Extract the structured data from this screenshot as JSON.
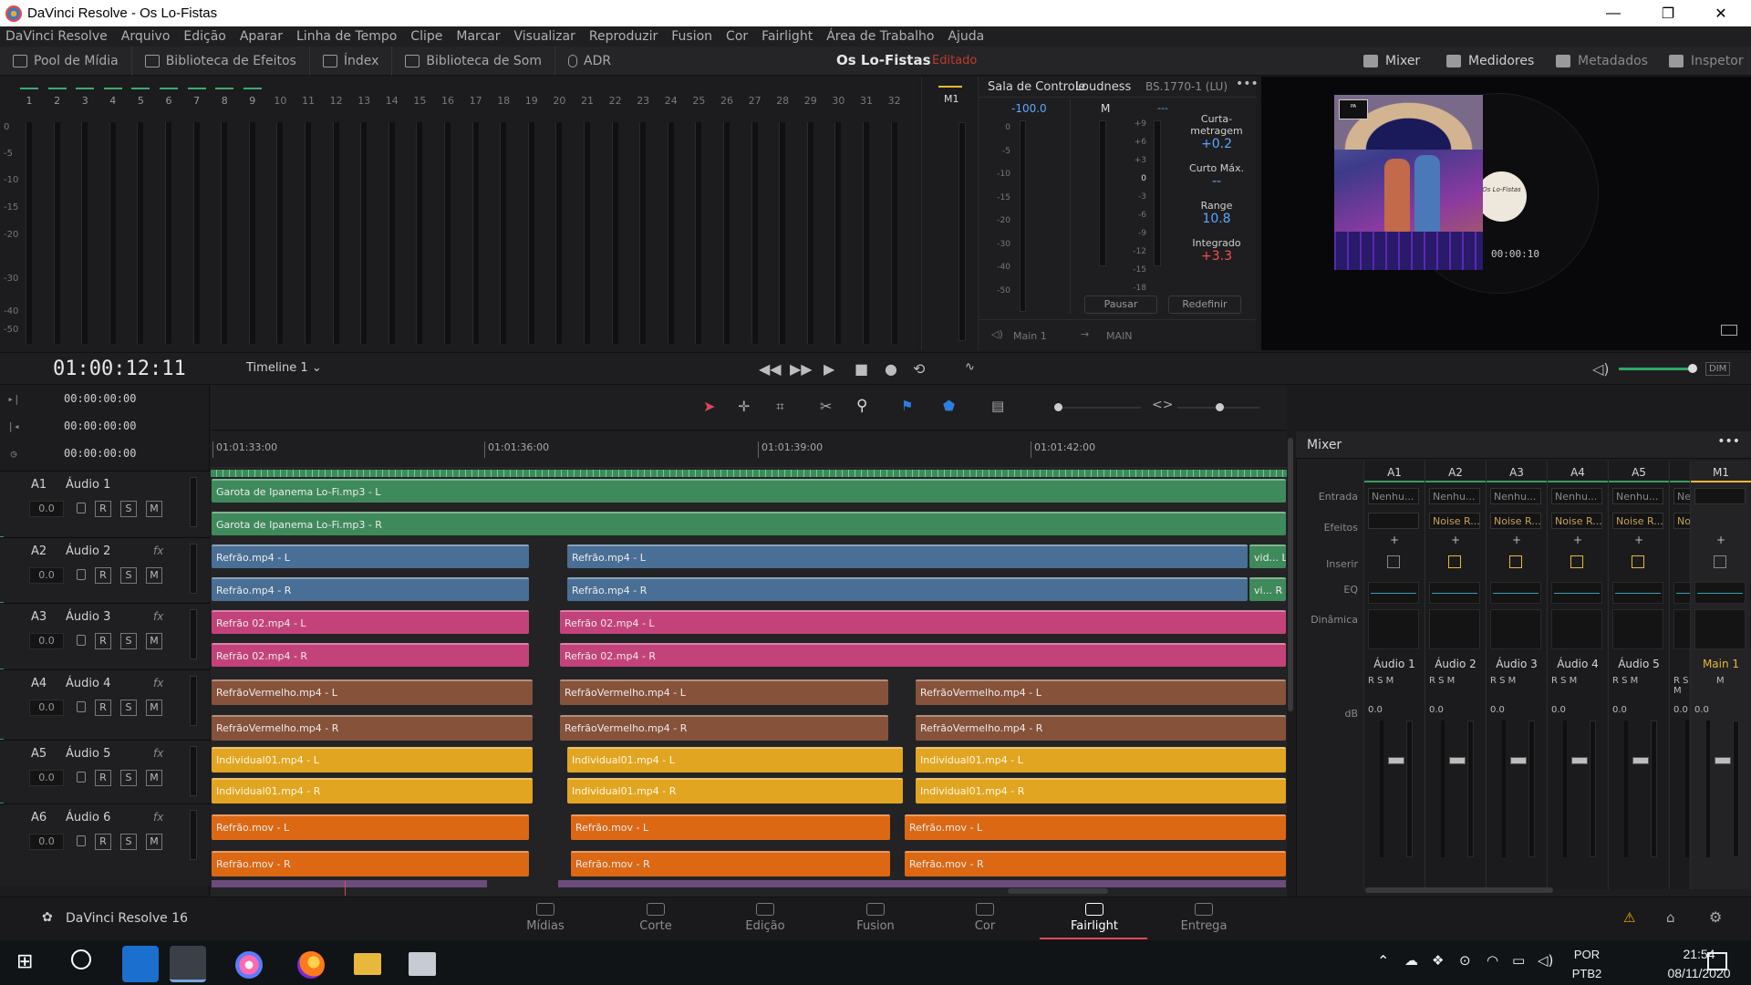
{
  "window": {
    "title": "DaVinci Resolve - Os Lo-Fistas",
    "controls": [
      "—",
      "❐",
      "✕"
    ]
  },
  "menu": [
    "DaVinci Resolve",
    "Arquivo",
    "Edição",
    "Aparar",
    "Linha de Tempo",
    "Clipe",
    "Marcar",
    "Visualizar",
    "Reproduzir",
    "Fusion",
    "Cor",
    "Fairlight",
    "Área de Trabalho",
    "Ajuda"
  ],
  "toolbar": {
    "left": [
      {
        "label": "Pool de Mídia",
        "icon": "media-pool-icon"
      },
      {
        "label": "Biblioteca de Efeitos",
        "icon": "effects-library-icon"
      },
      {
        "label": "Índex",
        "icon": "index-icon"
      },
      {
        "label": "Biblioteca de Som",
        "icon": "sound-library-icon"
      },
      {
        "label": "ADR",
        "icon": "microphone-icon"
      }
    ],
    "project_title": "Os Lo-Fistas",
    "project_status": "Editado",
    "right": [
      {
        "label": "Mixer",
        "icon": "mixer-icon"
      },
      {
        "label": "Medidores",
        "icon": "meters-icon"
      },
      {
        "label": "Metadados",
        "icon": "metadata-icon"
      },
      {
        "label": "Inspetor",
        "icon": "inspector-icon"
      }
    ]
  },
  "meters": {
    "channels": [
      "1",
      "2",
      "3",
      "4",
      "5",
      "6",
      "7",
      "8",
      "9",
      "10",
      "11",
      "12",
      "13",
      "14",
      "15",
      "16",
      "17",
      "18",
      "19",
      "20",
      "21",
      "22",
      "23",
      "24",
      "25",
      "26",
      "27",
      "28",
      "29",
      "30",
      "31",
      "32"
    ],
    "scale": [
      "0",
      "-5",
      "-10",
      "-15",
      "-20",
      "-30",
      "-40",
      "-50"
    ],
    "m1_label": "M1"
  },
  "control_room": {
    "title": "Sala de Controle",
    "level": "-100.0",
    "scale": [
      "0",
      "-5",
      "-10",
      "-15",
      "-20",
      "-30",
      "-40",
      "-50"
    ],
    "output": "Main 1",
    "route": "MAIN"
  },
  "loudness": {
    "title": "Loudness",
    "standard": "BS.1770-1 (LU)",
    "m_label": "M",
    "dash": "---",
    "scale": [
      "+9",
      "+6",
      "+3",
      "0",
      "-3",
      "-6",
      "-9",
      "-12",
      "-15",
      "-18"
    ],
    "readings": [
      {
        "label": "Curta-metragem",
        "value": "+0.2",
        "color": "#5aa7ff"
      },
      {
        "label": "Curto Máx.",
        "value": "--",
        "color": "#5aa7ff"
      },
      {
        "label": "Range",
        "value": "10.8",
        "color": "#5aa7ff"
      },
      {
        "label": "Integrado",
        "value": "+3.3",
        "color": "#ff4d4d"
      }
    ],
    "buttons": {
      "pause": "Pausar",
      "reset": "Redefinir"
    }
  },
  "viewer": {
    "record_text": "Os Lo-Fistas",
    "timecode_overlay": "00:00:10"
  },
  "transport": {
    "timecode": "01:00:12:11",
    "timeline": "Timeline 1"
  },
  "tc_rows": [
    "00:00:00:00",
    "00:00:00:00",
    "00:00:00:00"
  ],
  "ruler": [
    "01:01:33:00",
    "01:01:36:00",
    "01:01:39:00",
    "01:01:42:00"
  ],
  "tracks": [
    {
      "id": "A1",
      "name": "Áudio 1",
      "fx": "",
      "vol": "0.0"
    },
    {
      "id": "A2",
      "name": "Áudio 2",
      "fx": "fx",
      "vol": "0.0"
    },
    {
      "id": "A3",
      "name": "Áudio 3",
      "fx": "fx",
      "vol": "0.0"
    },
    {
      "id": "A4",
      "name": "Áudio 4",
      "fx": "fx",
      "vol": "0.0"
    },
    {
      "id": "A5",
      "name": "Áudio 5",
      "fx": "fx",
      "vol": "0.0"
    },
    {
      "id": "A6",
      "name": "Áudio 6",
      "fx": "fx",
      "vol": "0.0"
    }
  ],
  "track_buttons": [
    "R",
    "S",
    "M"
  ],
  "clips": {
    "a1": [
      "Garota de Ipanema Lo-Fi.mp3 - L",
      "Garota de Ipanema Lo-Fi.mp3 - R"
    ],
    "a2": [
      "Refrão.mp4 - L",
      "Refrão.mp4 - R",
      "Refrão.mp4 - L",
      "Refrão.mp4 - R",
      "vid... L",
      "vi... R"
    ],
    "a3": [
      "Refrão 02.mp4 - L",
      "Refrão 02.mp4 - R",
      "Refrão 02.mp4 - L",
      "Refrão 02.mp4 - R"
    ],
    "a4": [
      "RefrãoVermelho.mp4 - L",
      "RefrãoVermelho.mp4 - R",
      "RefrãoVermelho.mp4 - L",
      "RefrãoVermelho.mp4 - R",
      "RefrãoVermelho.mp4 - L",
      "RefrãoVermelho.mp4 - R"
    ],
    "a5": [
      "Individual01.mp4 - L",
      "Individual01.mp4 - R",
      "Individual01.mp4 - L",
      "Individual01.mp4 - R",
      "Individual01.mp4 - L",
      "Individual01.mp4 - R"
    ],
    "a6": [
      "Refrão.mov - L",
      "Refrão.mov - R",
      "Refrão.mov - L",
      "Refrão.mov - R",
      "Refrão.mov - L",
      "Refrão.mov - R"
    ]
  },
  "mixer": {
    "title": "Mixer",
    "row_labels": {
      "input": "Entrada",
      "effects": "Efeitos",
      "insert": "Inserir",
      "eq": "EQ",
      "dynamics": "Dinâmica",
      "db": "dB"
    },
    "channels": [
      {
        "id": "A1",
        "name": "Áudio 1",
        "input": "Nenhu...",
        "effect": "",
        "db": "0.0"
      },
      {
        "id": "A2",
        "name": "Áudio 2",
        "input": "Nenhu...",
        "effect": "Noise R...",
        "db": "0.0"
      },
      {
        "id": "A3",
        "name": "Áudio 3",
        "input": "Nenhu...",
        "effect": "Noise R...",
        "db": "0.0"
      },
      {
        "id": "A4",
        "name": "Áudio 4",
        "input": "Nenhu...",
        "effect": "Noise R...",
        "db": "0.0"
      },
      {
        "id": "A5",
        "name": "Áudio 5",
        "input": "Nenhu...",
        "effect": "Noise R...",
        "db": "0.0"
      },
      {
        "id": "A6",
        "name": "Áu",
        "input": "Ne",
        "effect": "No",
        "db": "0.0"
      }
    ],
    "main": {
      "id": "M1",
      "name": "Main 1",
      "db": "0.0"
    }
  },
  "pages": [
    {
      "label": "Mídias",
      "icon": "media-page-icon"
    },
    {
      "label": "Corte",
      "icon": "cut-page-icon"
    },
    {
      "label": "Edição",
      "icon": "edit-page-icon"
    },
    {
      "label": "Fusion",
      "icon": "fusion-page-icon"
    },
    {
      "label": "Cor",
      "icon": "color-page-icon"
    },
    {
      "label": "Fairlight",
      "icon": "fairlight-page-icon",
      "active": true
    },
    {
      "label": "Entrega",
      "icon": "deliver-page-icon"
    }
  ],
  "app_label": "DaVinci Resolve 16",
  "taskbar": {
    "lang": [
      "POR",
      "PTB2"
    ],
    "time": "21:54",
    "date": "08/11/2020"
  },
  "colors": {
    "accent_active": "#e0475a",
    "track_green": "#3c9b5c"
  }
}
